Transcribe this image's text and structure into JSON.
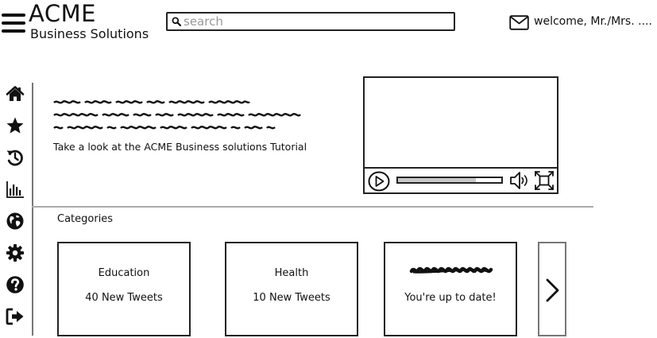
{
  "header": {
    "brand_name": "ACME",
    "brand_sub": "Business Solutions",
    "search_placeholder": "search",
    "welcome_text": "welcome, Mr./Mrs. ....",
    "menu_icon": "hamburger-icon",
    "mail_icon": "envelope-icon"
  },
  "sidebar": {
    "items": [
      {
        "icon": "home-icon"
      },
      {
        "icon": "star-icon"
      },
      {
        "icon": "history-icon"
      },
      {
        "icon": "bar-chart-icon"
      },
      {
        "icon": "globe-icon"
      },
      {
        "icon": "gear-icon"
      },
      {
        "icon": "help-icon"
      },
      {
        "icon": "sign-out-icon"
      }
    ]
  },
  "hero": {
    "tutorial_text": "Take a look at the ACME Business solutions Tutorial",
    "video": {
      "progress": 0.75,
      "controls": [
        "play-icon",
        "volume-icon",
        "fullscreen-icon"
      ]
    }
  },
  "categories": {
    "label": "Categories",
    "cards": [
      {
        "title": "Education",
        "count": "40 New Tweets"
      },
      {
        "title": "Health",
        "count": "10 New Tweets"
      },
      {
        "title": "",
        "count": "You're up to date!"
      }
    ],
    "next_icon": "chevron-right-icon"
  },
  "colors": {
    "ink": "#111111",
    "placeholder": "#999999",
    "divider": "#aaaaaa",
    "progress_fill": "#c8c8c8"
  }
}
